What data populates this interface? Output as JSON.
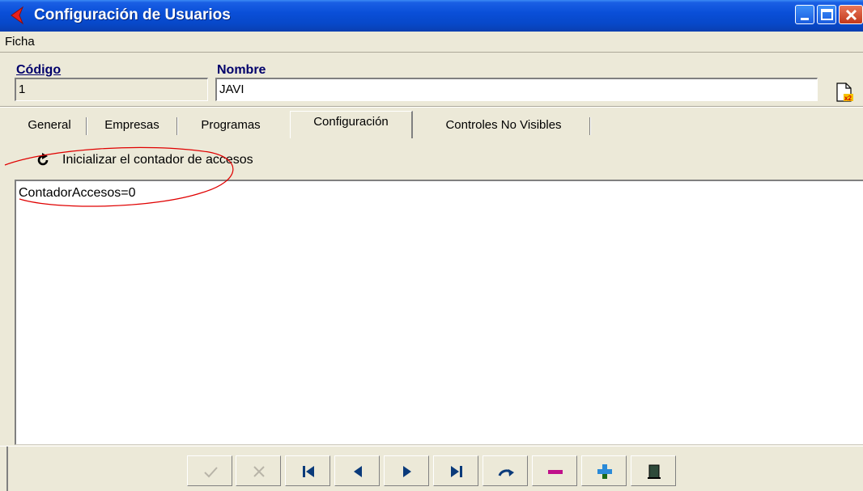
{
  "window": {
    "title": "Configuración de Usuarios",
    "title_icon": "red-chevron-left-icon",
    "buttons": [
      "minimize-icon",
      "maximize-icon",
      "close-icon"
    ],
    "colors": {
      "titlebar": "#0a4fd8",
      "face": "#ece9d8",
      "label_blue": "#00006b",
      "annotation_red": "#e00000"
    }
  },
  "menu": {
    "items": [
      "Ficha"
    ]
  },
  "fields": {
    "code_label": "Código",
    "code_value": "1",
    "name_label": "Nombre",
    "name_value": "JAVI",
    "copy_icon": "document-x2-icon"
  },
  "tabs": [
    {
      "label": "General",
      "active": false
    },
    {
      "label": "Empresas",
      "active": false
    },
    {
      "label": "Programas",
      "active": false
    },
    {
      "label": "Configuración",
      "active": true
    },
    {
      "label": "Controles No Visibles",
      "active": false
    }
  ],
  "config": {
    "reset_icon": "refresh-icon",
    "reset_label": "Inicializar el contador de accesos",
    "memo_text": "ContadorAccesos=0"
  },
  "navigator": {
    "buttons": [
      {
        "name": "confirm-icon",
        "enabled": false
      },
      {
        "name": "cancel-icon",
        "enabled": false
      },
      {
        "name": "first-record-icon",
        "enabled": true
      },
      {
        "name": "prior-record-icon",
        "enabled": true
      },
      {
        "name": "next-record-icon",
        "enabled": true
      },
      {
        "name": "last-record-icon",
        "enabled": true
      },
      {
        "name": "refresh-icon",
        "enabled": true
      },
      {
        "name": "delete-icon",
        "enabled": true
      },
      {
        "name": "add-icon",
        "enabled": true
      },
      {
        "name": "exit-door-icon",
        "enabled": true
      }
    ]
  }
}
